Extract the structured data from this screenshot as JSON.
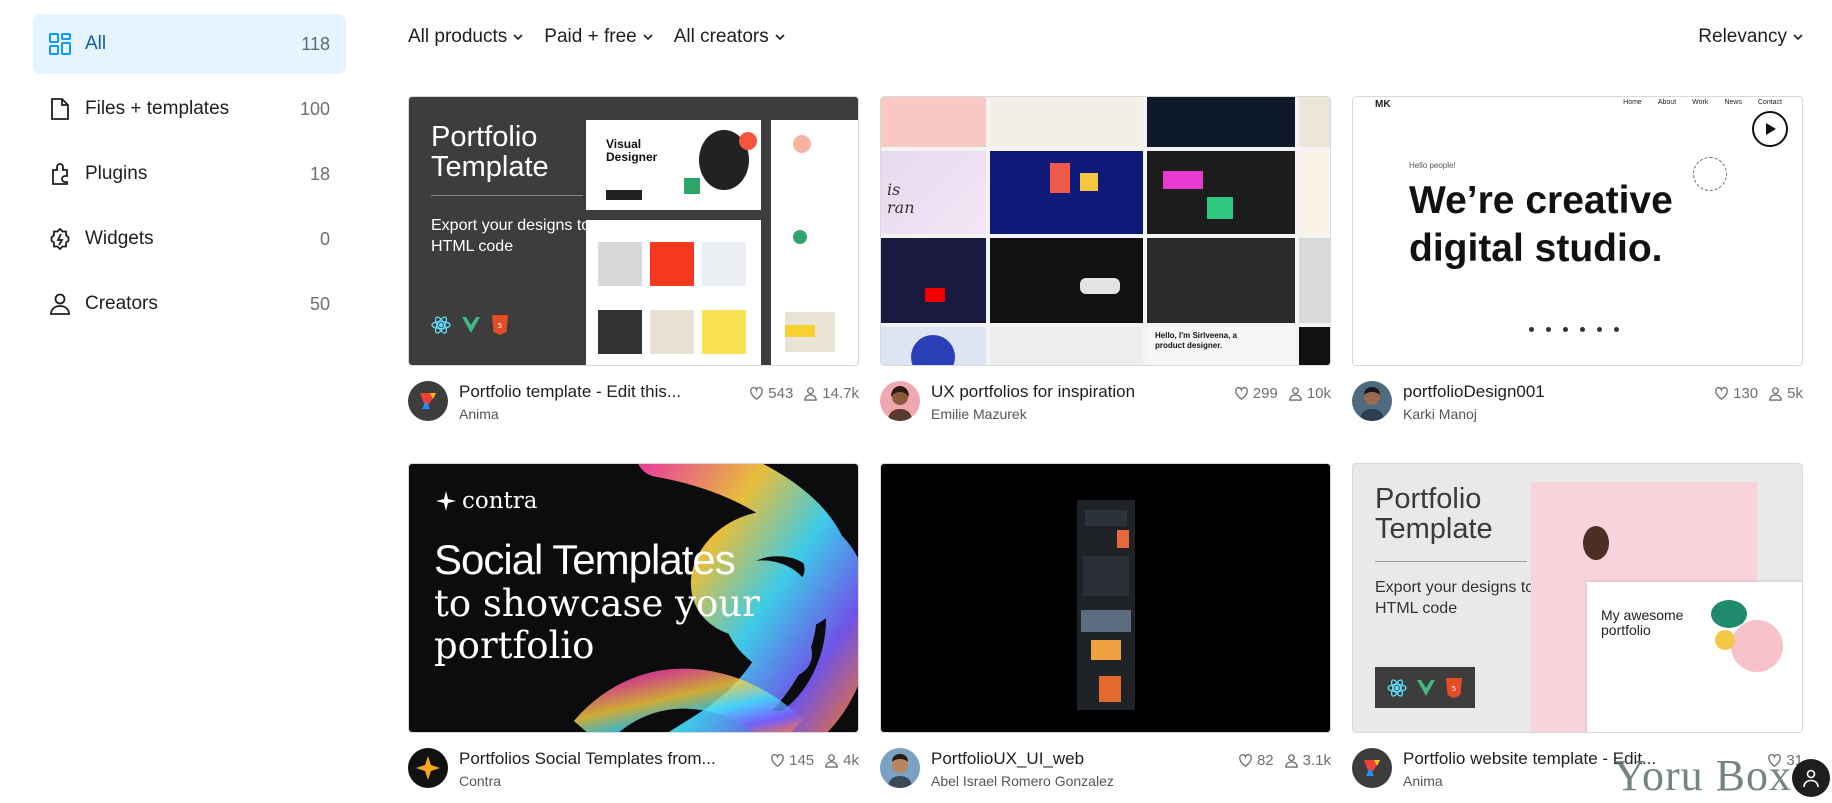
{
  "sidebar": {
    "items": [
      {
        "label": "All",
        "count": "118",
        "icon": "grid-icon",
        "active": true
      },
      {
        "label": "Files + templates",
        "count": "100",
        "icon": "file-icon"
      },
      {
        "label": "Plugins",
        "count": "18",
        "icon": "plugin-icon"
      },
      {
        "label": "Widgets",
        "count": "0",
        "icon": "widget-icon"
      },
      {
        "label": "Creators",
        "count": "50",
        "icon": "person-icon"
      }
    ]
  },
  "filters": {
    "products": "All products",
    "pricing": "Paid + free",
    "creators": "All creators",
    "sort": "Relevancy"
  },
  "cards": [
    {
      "title": "Portfolio template - Edit this...",
      "creator": "Anima",
      "likes": "543",
      "users": "14.7k",
      "thumb": {
        "heading": "Portfolio Template",
        "sub": "Export your designs to HTML code"
      }
    },
    {
      "title": "UX portfolios for inspiration",
      "creator": "Emilie Mazurek",
      "likes": "299",
      "users": "10k"
    },
    {
      "title": "portfolioDesign001",
      "creator": "Karki Manoj",
      "likes": "130",
      "users": "5k",
      "thumb": {
        "logo": "MK",
        "hello": "Hello people!",
        "headline1": "We’re creative",
        "headline2": "digital studio.",
        "nav": [
          "Home",
          "About",
          "Work",
          "News",
          "Contact"
        ]
      }
    },
    {
      "title": "Portfolios Social Templates from...",
      "creator": "Contra",
      "likes": "145",
      "users": "4k",
      "thumb": {
        "brand": "contra",
        "line1": "Social Templates",
        "line2": "to showcase your",
        "line3": "portfolio"
      }
    },
    {
      "title": "PortfolioUX_UI_web",
      "creator": "Abel Israel Romero Gonzalez",
      "likes": "82",
      "users": "3.1k"
    },
    {
      "title": "Portfolio website template - Edit...",
      "creator": "Anima",
      "likes": "31",
      "users": "",
      "thumb": {
        "heading": "Portfolio Template",
        "sub": "Export your designs to HTML code",
        "preview": "My awesome portfolio"
      }
    }
  ],
  "watermark": "Yoru Box",
  "colors": {
    "accent": "#0d99ff",
    "activeBg": "#e5f4ff",
    "anima": "#3d3d3d"
  }
}
